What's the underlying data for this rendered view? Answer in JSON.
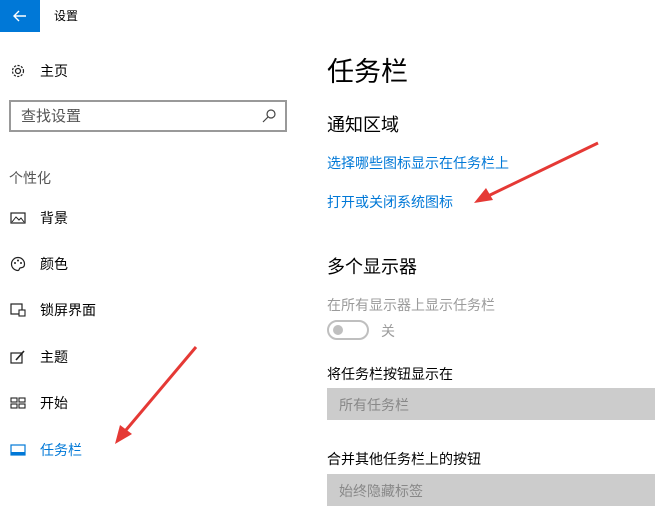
{
  "window": {
    "title": "设置",
    "back_icon": "arrow-left-icon",
    "accent": "#0078d7"
  },
  "sidebar": {
    "home": {
      "label": "主页",
      "icon": "gear-icon"
    },
    "search": {
      "placeholder": "查找设置",
      "icon": "search-icon"
    },
    "section_header": "个性化",
    "items": [
      {
        "label": "背景",
        "icon": "picture-icon"
      },
      {
        "label": "颜色",
        "icon": "palette-icon"
      },
      {
        "label": "锁屏界面",
        "icon": "lock-screen-icon"
      },
      {
        "label": "主题",
        "icon": "theme-brush-icon"
      },
      {
        "label": "开始",
        "icon": "start-tiles-icon"
      },
      {
        "label": "任务栏",
        "icon": "taskbar-icon",
        "selected": true
      }
    ]
  },
  "main": {
    "title": "任务栏",
    "notification_area": {
      "heading": "通知区域",
      "link1": "选择哪些图标显示在任务栏上",
      "link2": "打开或关闭系统图标"
    },
    "multiple_displays": {
      "heading": "多个显示器",
      "show_taskbar_label": "在所有显示器上显示任务栏",
      "toggle_state": "关",
      "buttons_label": "将任务栏按钮显示在",
      "buttons_value": "所有任务栏",
      "combine_label": "合并其他任务栏上的按钮",
      "combine_value": "始终隐藏标签"
    }
  },
  "annotations": {
    "arrow_color": "#e53935"
  }
}
